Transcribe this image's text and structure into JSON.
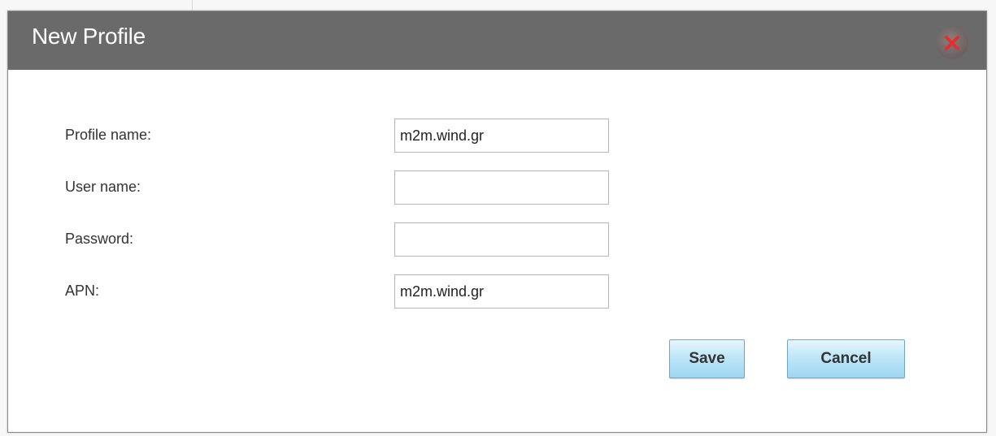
{
  "dialog": {
    "title": "New Profile",
    "close_icon": "close-icon",
    "close_color": "#e03030"
  },
  "form": {
    "fields": [
      {
        "label": "Profile name:",
        "value": "m2m.wind.gr"
      },
      {
        "label": "User name:",
        "value": ""
      },
      {
        "label": "Password:",
        "value": ""
      },
      {
        "label": "APN:",
        "value": "m2m.wind.gr"
      }
    ]
  },
  "buttons": {
    "save_label": "Save",
    "cancel_label": "Cancel"
  },
  "colors": {
    "titlebar": "#6a6a6a",
    "button_accent": "#9fd6f2"
  }
}
